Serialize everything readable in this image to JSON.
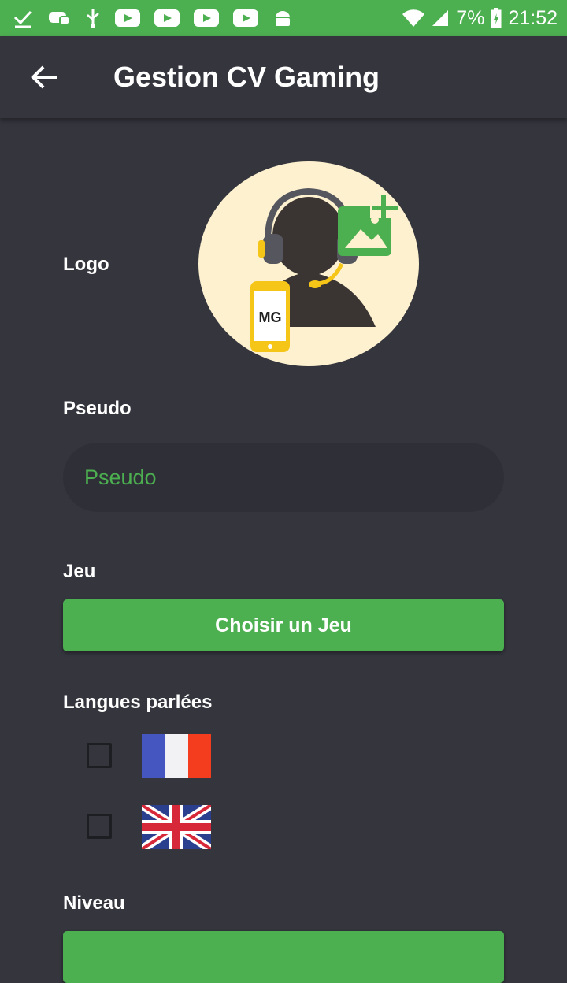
{
  "status_bar": {
    "battery_percent": "7%",
    "time": "21:52",
    "icons": [
      "check-icon",
      "discord-icon",
      "usb-icon",
      "youtube-icon",
      "youtube-icon",
      "youtube-icon",
      "youtube-icon",
      "android-icon",
      "wifi-icon",
      "signal-icon",
      "battery-icon"
    ]
  },
  "app_bar": {
    "title": "Gestion CV Gaming",
    "back_icon": "arrow-back-icon"
  },
  "form": {
    "logo_label": "Logo",
    "avatar_badge": "MG",
    "pseudo_label": "Pseudo",
    "pseudo_placeholder": "Pseudo",
    "pseudo_value": "",
    "jeu_label": "Jeu",
    "choose_game_button": "Choisir un Jeu",
    "languages_label": "Langues parlées",
    "languages": [
      {
        "flag": "france-flag",
        "checked": false
      },
      {
        "flag": "uk-flag",
        "checked": false
      }
    ],
    "niveau_label": "Niveau"
  },
  "colors": {
    "accent": "#4caf50",
    "background": "#34353d",
    "input_bg": "#2f3037",
    "avatar_bg": "#fdf1d0"
  }
}
